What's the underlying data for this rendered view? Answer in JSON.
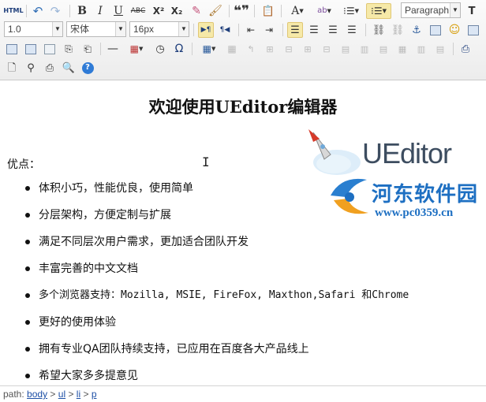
{
  "toolbar": {
    "html_label": "HTML",
    "paragraph_value": "Paragraph",
    "line_height_value": "1.0",
    "font_family_value": "宋体",
    "font_size_value": "16px",
    "ltr_label": "▶¶",
    "rtl_label": "¶◀",
    "omega_label": "Ω",
    "quote_label": "❝❞",
    "colors": {
      "active_bg": "#f6e9a8",
      "help_blue": "#2f7bd6"
    }
  },
  "content": {
    "title": "欢迎使用UEditor编辑器",
    "pros_label": "优点：",
    "items": [
      "体积小巧，性能优良，使用简单",
      "分层架构，方便定制与扩展",
      "满足不同层次用户需求，更加适合团队开发",
      "丰富完善的中文文档",
      "多个浏览器支持：Mozilla, MSIE, FireFox, Maxthon,Safari 和Chrome",
      "更好的使用体验",
      "拥有专业QA团队持续支持，已应用在百度各大产品线上",
      "希望大家多多提意见"
    ],
    "logo_text": "UEditor",
    "cursor": "I"
  },
  "watermark": {
    "site_name": "河东软件园",
    "url": "www.pc0359.cn"
  },
  "status": {
    "prefix": "path:",
    "crumbs": [
      "body",
      "ul",
      "li",
      "p"
    ]
  }
}
